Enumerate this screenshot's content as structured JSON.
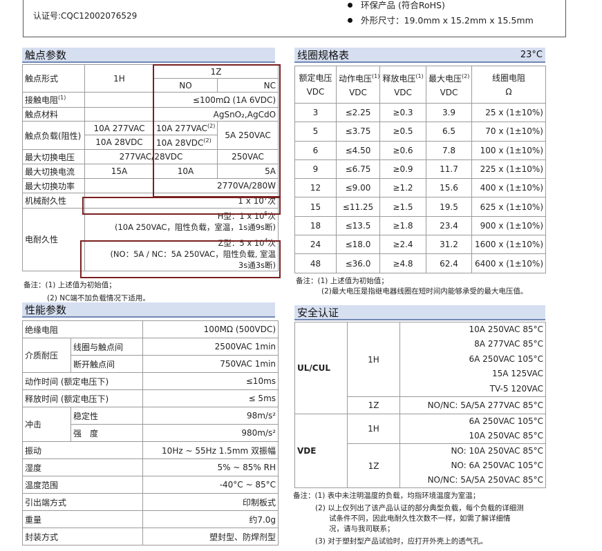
{
  "header": {
    "cert": "认证号:CQC12002076529",
    "features": [
      "环保产品 (符合RoHS)",
      "外形尺寸：19.0mm x 15.2mm x 15.5mm"
    ]
  },
  "contact": {
    "title": "触点参数",
    "form_label": "触点形式",
    "form_1h": "1H",
    "form_1z": "1Z",
    "no": "NO",
    "nc": "NC",
    "resistance_label": "接触电阻",
    "resistance_sup": "(1)",
    "resistance": "≤100mΩ (1A 6VDC)",
    "material_label": "触点材料",
    "material": "AgSnO₂,AgCdO",
    "load_label": "触点负载(阻性)",
    "load_1h_a": "10A 277VAC",
    "load_1h_b": "10A 28VDC",
    "load_no_a": "10A 277VAC",
    "load_no_b": "10A 28VDC",
    "load_sup": "(2)",
    "load_nc": "5A 250VAC",
    "maxv_label": "最大切换电压",
    "maxv_a": "277VAC/28VDC",
    "maxv_b": "250VAC",
    "maxi_label": "最大切换电流",
    "maxi_1h": "15A",
    "maxi_no": "10A",
    "maxi_nc": "5A",
    "maxp_label": "最大切换功率",
    "maxp": "2770VA/280W",
    "mech_label": "机械耐久性",
    "mech": "1 x 10",
    "mech_exp": "7",
    "mech_unit": "次",
    "elec_label": "电耐久性",
    "elec_h": "H型：1 x 10",
    "elec_h_exp": "5",
    "elec_h_unit": "次",
    "elec_h2": "(10A 250VAC，阻性负载，室温，1s通9s断)",
    "elec_z": "Z型：5 x 10",
    "elec_z_exp": "4",
    "elec_z_unit": "次",
    "elec_z2": "(NO：5A / NC：5A 250VAC，阻性负载, 室温",
    "elec_z3": "3s通3s断)",
    "note1": "备注：(1) 上述值为初始值；",
    "note2": "(2) NC端不加负载情况下适用。"
  },
  "coil": {
    "title": "线圈规格表",
    "temp": "23°C",
    "headers": [
      "额定电压",
      "动作电压",
      "释放电压",
      "最大电压",
      "线圈电阻"
    ],
    "units": [
      "VDC",
      "VDC",
      "VDC",
      "VDC",
      "Ω"
    ],
    "rows": [
      [
        "3",
        "≤2.25",
        "≥0.3",
        "3.9",
        "25 x (1±10%)"
      ],
      [
        "5",
        "≤3.75",
        "≥0.5",
        "6.5",
        "70 x (1±10%)"
      ],
      [
        "6",
        "≤4.50",
        "≥0.6",
        "7.8",
        "100 x (1±10%)"
      ],
      [
        "9",
        "≤6.75",
        "≥0.9",
        "11.7",
        "225 x (1±10%)"
      ],
      [
        "12",
        "≤9.00",
        "≥1.2",
        "15.6",
        "400 x (1±10%)"
      ],
      [
        "15",
        "≤11.25",
        "≥1.5",
        "19.5",
        "625 x (1±10%)"
      ],
      [
        "18",
        "≤13.5",
        "≥1.8",
        "23.4",
        "900 x (1±10%)"
      ],
      [
        "24",
        "≤18.0",
        "≥2.4",
        "31.2",
        "1600 x (1±10%)"
      ],
      [
        "48",
        "≤36.0",
        "≥4.8",
        "62.4",
        "6400 x (1±10%)"
      ]
    ],
    "note1": "备注：(1) 上述值为初始值；",
    "note2": "(2)最大电压是指继电器线圈在短时间内能够承受的最大电压值。"
  },
  "perf": {
    "title": "性能参数",
    "rows": [
      [
        "绝缘电阻",
        "",
        "100MΩ (500VDC)"
      ],
      [
        "介质耐压",
        "线圈与触点间",
        "2500VAC 1min"
      ],
      [
        "",
        "断开触点间",
        "750VAC 1min"
      ],
      [
        "动作时间 (额定电压下)",
        "",
        "≤10ms"
      ],
      [
        "释放时间 (额定电压下)",
        "",
        "≤ 5ms"
      ],
      [
        "冲击",
        "稳定性",
        "98m/s²"
      ],
      [
        "",
        "强　度",
        "980m/s²"
      ],
      [
        "振动",
        "",
        "10Hz ~ 55Hz 1.5mm 双振幅"
      ],
      [
        "湿度",
        "",
        "5% ~ 85% RH"
      ],
      [
        "温度范围",
        "",
        "-40°C ~ 85°C"
      ],
      [
        "引出端方式",
        "",
        "印制板式"
      ],
      [
        "重量",
        "",
        "约7.0g"
      ],
      [
        "封装方式",
        "",
        "塑封型、防焊剂型"
      ]
    ]
  },
  "safety": {
    "title": "安全认证",
    "ul": "UL/CUL",
    "vde": "VDE",
    "h1": "1H",
    "z1": "1Z",
    "ul_1h": [
      "10A 250VAC  85°C",
      "8A 277VAC  85°C",
      "6A 250VAC  105°C",
      "15A 125VAC",
      "TV-5 120VAC"
    ],
    "ul_1z": [
      "NO/NC: 5A/5A 277VAC  85°C"
    ],
    "vde_1h": [
      "6A 250VAC  105°C",
      "10A 250VAC  85°C"
    ],
    "vde_1z": [
      "NO: 10A 250VAC  85°C",
      "NO: 6A 250VAC  105°C",
      "NO/NC: 5A/5A 250VAC  85°C"
    ],
    "notes": [
      "备注：(1) 表中未注明温度的负载，均指环境温度为室温；",
      "(2) 以上仅列出了该产品认证的部分典型负载，每个负载的详细测",
      "试条件不同，因此电耐久性次数不一样，如需了解详细情",
      "况，请与我司联系；",
      "(3) 对于塑封型产品试验时，应打开外壳上的透气孔。"
    ]
  }
}
